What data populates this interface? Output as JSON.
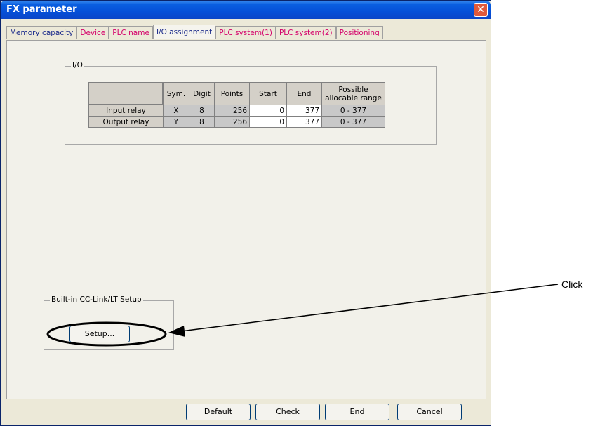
{
  "window": {
    "title": "FX parameter"
  },
  "tabs": [
    {
      "label": "Memory capacity"
    },
    {
      "label": "Device"
    },
    {
      "label": "PLC name"
    },
    {
      "label": "I/O assignment"
    },
    {
      "label": "PLC system(1)"
    },
    {
      "label": "PLC system(2)"
    },
    {
      "label": "Positioning"
    }
  ],
  "io_group": {
    "label": "I/O",
    "headers": {
      "sym": "Sym.",
      "digit": "Digit",
      "points": "Points",
      "start": "Start",
      "end": "End",
      "range_line1": "Possible",
      "range_line2": "allocable range"
    },
    "rows": [
      {
        "label": "Input relay",
        "sym": "X",
        "digit": "8",
        "points": "256",
        "start": "0",
        "end": "377",
        "range": "0 - 377"
      },
      {
        "label": "Output relay",
        "sym": "Y",
        "digit": "8",
        "points": "256",
        "start": "0",
        "end": "377",
        "range": "0 - 377"
      }
    ]
  },
  "cclink_group": {
    "label": "Built-in CC-Link/LT Setup",
    "setup_button": "Setup..."
  },
  "footer": {
    "default": "Default",
    "check": "Check",
    "end": "End",
    "cancel": "Cancel"
  },
  "annotation": {
    "text": "Click"
  }
}
